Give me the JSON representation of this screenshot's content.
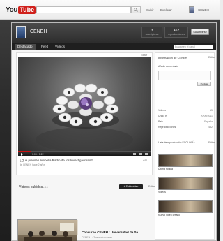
{
  "masthead": {
    "logo_you": "You",
    "logo_tube": "Tube",
    "search_placeholder": "",
    "links": [
      "Subir",
      "Explorar"
    ],
    "user": "CENEH"
  },
  "channel": {
    "name": "CENEH",
    "stats": [
      {
        "num": "3",
        "lbl": "suscriptores"
      },
      {
        "num": "452",
        "lbl": "reproducciones"
      }
    ],
    "subscribe_label": "Suscribirse"
  },
  "tabs": [
    "Destacado",
    "Feed",
    "Vídeos"
  ],
  "tab_search_placeholder": "Buscar en el canal",
  "video": {
    "edit_label": "Editar",
    "time": "0:00 / 0:22",
    "progress": 0.1,
    "title": "¿Qué piensan Ampolla Radio de los Investigadores?",
    "meta": "de CENEH hace 2 años",
    "views": "235"
  },
  "uploads": {
    "header": "Vídeos subidos",
    "count": "1 de 15",
    "button": "+ Subir vídeo",
    "more": "Editar",
    "item_title": "Concurso CENEH : Universidad de Se...",
    "item_meta": "CENEH · 42 reproducciones"
  },
  "info": {
    "title": "Información de CENEH",
    "edit": "Editar",
    "comment_label": "Añadir comentario",
    "post_btn": "Publicar",
    "stats": [
      {
        "k": "Vídeos",
        "v": "15"
      },
      {
        "k": "Unido el",
        "v": "20/09/2011"
      },
      {
        "k": "País",
        "v": "España"
      },
      {
        "k": "Reproducciones",
        "v": "452"
      }
    ],
    "playlist_title": "Lista de reproducción ECOLOGÍA",
    "playlist_edit": "Editar",
    "items": [
      "Última noticia",
      "Vídeos",
      "Nuevo vídeo creado"
    ]
  }
}
